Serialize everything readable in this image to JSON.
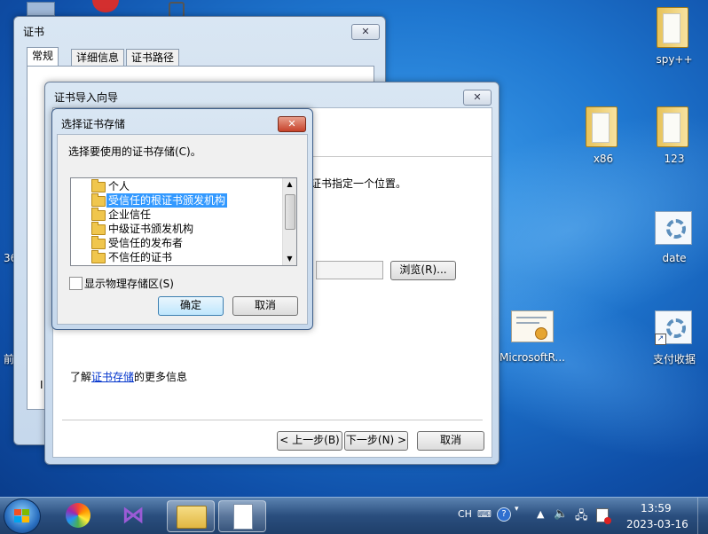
{
  "desktop": {
    "icons": [
      {
        "label": "spy++",
        "icon": "folder-icon"
      },
      {
        "label": "x86",
        "icon": "folder-icon"
      },
      {
        "label": "123",
        "icon": "folder-icon"
      },
      {
        "label": "date",
        "icon": "gear-icon"
      },
      {
        "label": "MicrosoftR...",
        "icon": "certificate-icon"
      },
      {
        "label": "支付收据",
        "icon": "gear-icon"
      }
    ],
    "edge_text": [
      "36",
      "前"
    ]
  },
  "cert_window": {
    "title": "证书",
    "tabs": [
      "常规",
      "详细信息",
      "证书路径"
    ],
    "partial_text": "I"
  },
  "wizard": {
    "title": "证书导入向导",
    "location_text": "证书指定一个位置。",
    "browse_button": "浏览(R)...",
    "learn_prefix": "了解",
    "learn_link": "证书存储",
    "learn_suffix": "的更多信息",
    "back_button": "< 上一步(B)",
    "next_button": "下一步(N) >",
    "cancel_button": "取消"
  },
  "store_dialog": {
    "title": "选择证书存储",
    "prompt": "选择要使用的证书存储(C)。",
    "stores": [
      "个人",
      "受信任的根证书颁发机构",
      "企业信任",
      "中级证书颁发机构",
      "受信任的发布者",
      "不信任的证书"
    ],
    "selected_index": 1,
    "show_physical_label": "显示物理存储区(S)",
    "show_physical_checked": false,
    "ok_button": "确定",
    "cancel_button": "取消"
  },
  "taskbar": {
    "lang": "CH",
    "time": "13:59",
    "date": "2023-03-16"
  }
}
